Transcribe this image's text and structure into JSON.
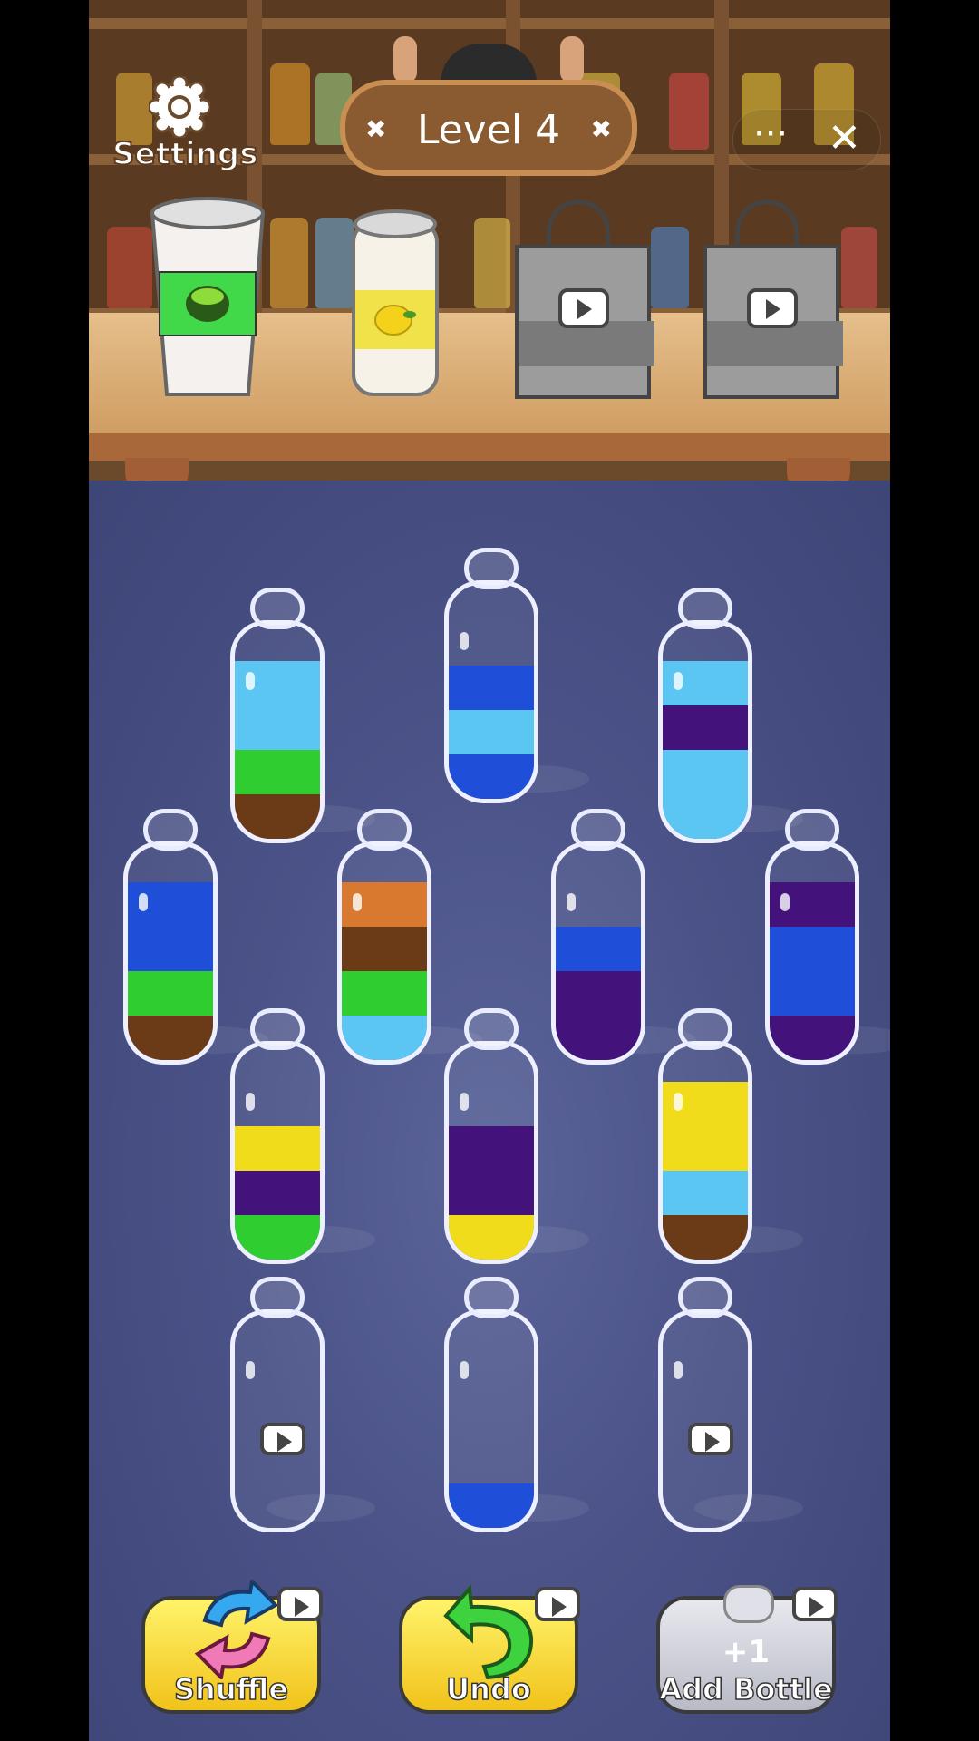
{
  "top_bar": {
    "settings_label": "Settings",
    "level_label": "Level 4",
    "menu_more": "···",
    "menu_close": "✕"
  },
  "orders": [
    {
      "type": "cup",
      "band_color": "#41d84a"
    },
    {
      "type": "can",
      "band_color": "#f2e24a"
    },
    {
      "type": "bag",
      "locked": true,
      "icon": "video-icon"
    },
    {
      "type": "bag",
      "locked": true,
      "icon": "video-icon"
    }
  ],
  "colors": {
    "light_blue": "#5cc6f2",
    "blue": "#1f4fd8",
    "green": "#2fcd2f",
    "brown": "#6b3a16",
    "purple": "#43127a",
    "orange": "#d9792f",
    "yellow": "#f0dc1a"
  },
  "bottles": [
    {
      "segments": [
        "brown",
        "green",
        "light_blue",
        "light_blue"
      ],
      "locked": false
    },
    {
      "segments": [
        "blue",
        "light_blue",
        "blue"
      ],
      "locked": false
    },
    {
      "segments": [
        "light_blue",
        "light_blue",
        "purple",
        "light_blue"
      ],
      "locked": false
    },
    {
      "segments": [
        "brown",
        "green",
        "blue",
        "blue"
      ],
      "locked": false
    },
    {
      "segments": [
        "light_blue",
        "green",
        "brown",
        "orange"
      ],
      "locked": false
    },
    {
      "segments": [
        "purple",
        "purple",
        "blue"
      ],
      "locked": false
    },
    {
      "segments": [
        "purple",
        "blue",
        "blue",
        "purple"
      ],
      "locked": false
    },
    {
      "segments": [
        "green",
        "purple",
        "yellow"
      ],
      "locked": false
    },
    {
      "segments": [
        "yellow",
        "purple",
        "purple"
      ],
      "locked": false
    },
    {
      "segments": [
        "brown",
        "light_blue",
        "yellow",
        "yellow"
      ],
      "locked": false
    },
    {
      "segments": [],
      "locked": true
    },
    {
      "segments": [
        "blue"
      ],
      "locked": false
    },
    {
      "segments": [],
      "locked": true
    }
  ],
  "buttons": {
    "shuffle": "Shuffle",
    "undo": "Undo",
    "add_bottle": "Add Bottle",
    "add_bottle_badge": "+1"
  }
}
